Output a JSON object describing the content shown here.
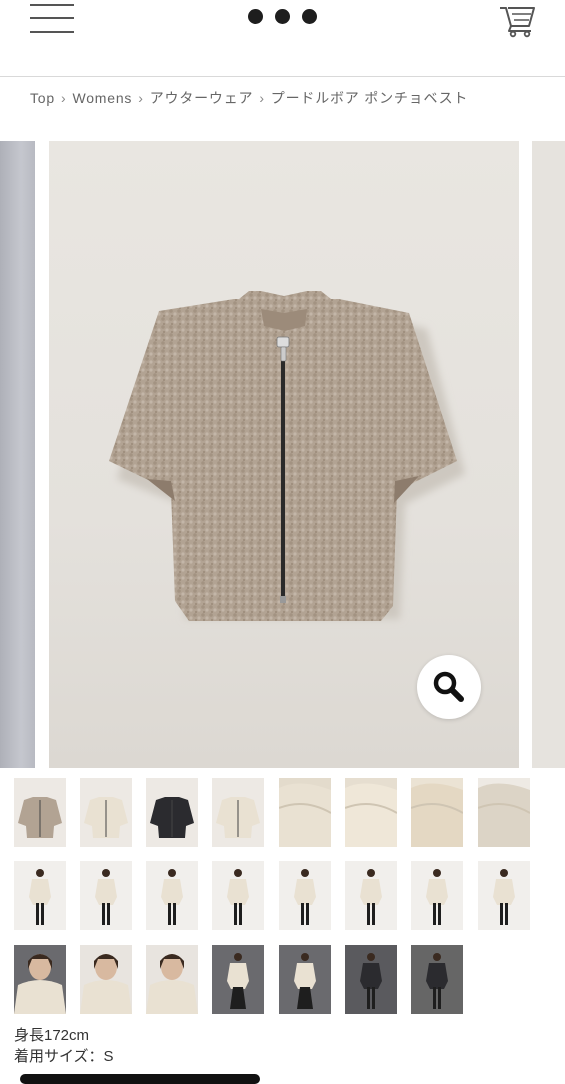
{
  "header": {
    "menu_icon": "hamburger-menu-icon",
    "logo_icon": "three-dot-logo",
    "cart_icon": "shopping-cart-icon"
  },
  "breadcrumb": [
    {
      "label": "Top"
    },
    {
      "label": "Womens"
    },
    {
      "label": "アウターウェア"
    },
    {
      "label": "プードルボア ポンチョベスト"
    }
  ],
  "breadcrumb_separator_icon": "chevron-right-icon",
  "gallery": {
    "zoom_icon": "magnifier-icon",
    "main_product_color": "#b4a596"
  },
  "thumbnails": {
    "row1": [
      "mocha-flat",
      "ivory-flat",
      "black-flat",
      "ivory-flat-2",
      "ivory-collar-detail",
      "ivory-sleeve-detail",
      "ivory-hem-detail",
      "ivory-lining-detail"
    ],
    "row2": [
      "model-ivory-front",
      "model-ivory-open",
      "model-ivory-full-1",
      "model-ivory-full-2",
      "model-ivory-full-3",
      "model-ivory-full-4",
      "model-ivory-side",
      "model-ivory-back"
    ],
    "row3": [
      "model-ivory-crop",
      "model-ivory-closeup",
      "model-ivory-collar",
      "model-ivory-skirt",
      "model-ivory-skirt-2",
      "model-black-front",
      "model-black-full"
    ]
  },
  "model_info": {
    "height": "身長172cm",
    "size": "着用サイズ：S"
  }
}
